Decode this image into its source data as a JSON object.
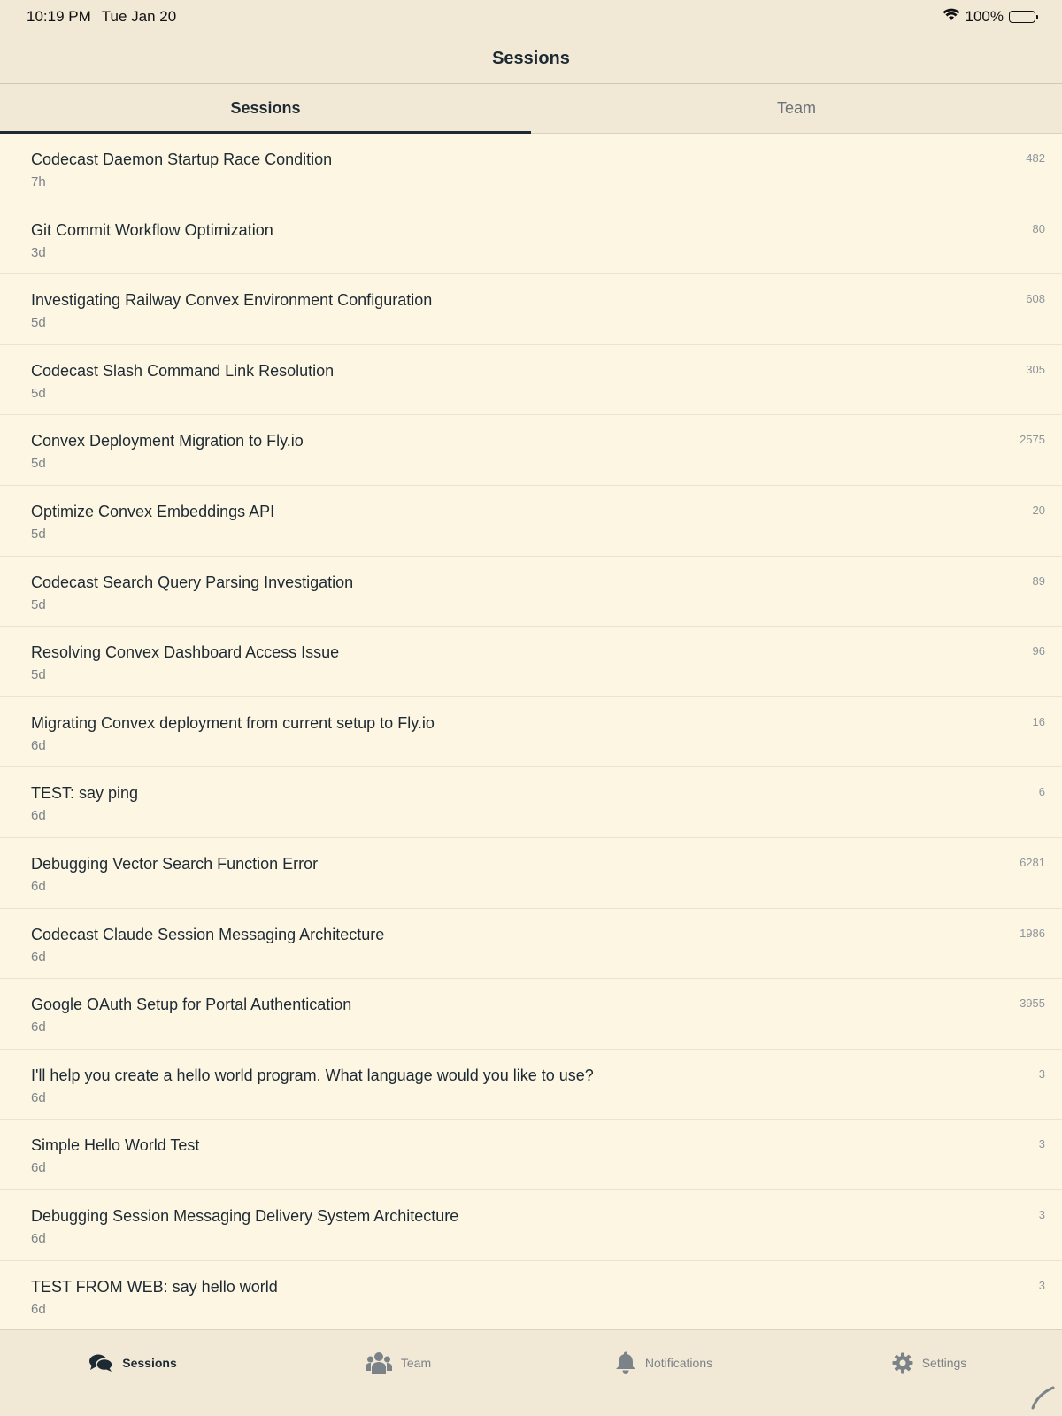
{
  "status_bar": {
    "time": "10:19 PM",
    "date": "Tue Jan 20",
    "battery": "100%"
  },
  "nav": {
    "title": "Sessions"
  },
  "tabs": [
    {
      "label": "Sessions",
      "active": true
    },
    {
      "label": "Team",
      "active": false
    }
  ],
  "sessions": [
    {
      "title": "Codecast Daemon Startup Race Condition",
      "age": "7h",
      "count": "482"
    },
    {
      "title": "Git Commit Workflow Optimization",
      "age": "3d",
      "count": "80"
    },
    {
      "title": "Investigating Railway Convex Environment Configuration",
      "age": "5d",
      "count": "608"
    },
    {
      "title": "Codecast Slash Command Link Resolution",
      "age": "5d",
      "count": "305"
    },
    {
      "title": "Convex Deployment Migration to Fly.io",
      "age": "5d",
      "count": "2575"
    },
    {
      "title": "Optimize Convex Embeddings API",
      "age": "5d",
      "count": "20"
    },
    {
      "title": "Codecast Search Query Parsing Investigation",
      "age": "5d",
      "count": "89"
    },
    {
      "title": "Resolving Convex Dashboard Access Issue",
      "age": "5d",
      "count": "96"
    },
    {
      "title": "Migrating Convex deployment from current setup to Fly.io",
      "age": "6d",
      "count": "16"
    },
    {
      "title": "TEST: say ping",
      "age": "6d",
      "count": "6"
    },
    {
      "title": "Debugging Vector Search Function Error",
      "age": "6d",
      "count": "6281"
    },
    {
      "title": "Codecast Claude Session Messaging Architecture",
      "age": "6d",
      "count": "1986"
    },
    {
      "title": "Google OAuth Setup for Portal Authentication",
      "age": "6d",
      "count": "3955"
    },
    {
      "title": "I'll help you create a hello world program. What language would you like to use?",
      "age": "6d",
      "count": "3"
    },
    {
      "title": "Simple Hello World Test",
      "age": "6d",
      "count": "3"
    },
    {
      "title": "Debugging Session Messaging Delivery System Architecture",
      "age": "6d",
      "count": "3"
    },
    {
      "title": "TEST FROM WEB: say hello world",
      "age": "6d",
      "count": "3"
    }
  ],
  "bottom_nav": [
    {
      "label": "Sessions",
      "icon": "chat-bubbles-icon",
      "active": true
    },
    {
      "label": "Team",
      "icon": "people-icon",
      "active": false
    },
    {
      "label": "Notifications",
      "icon": "bell-icon",
      "active": false
    },
    {
      "label": "Settings",
      "icon": "gear-icon",
      "active": false
    }
  ],
  "colors": {
    "background": "#fdf6e3",
    "bar_background": "#f1e9d6",
    "text_primary": "#1e2a33",
    "text_secondary": "#7b8288"
  }
}
